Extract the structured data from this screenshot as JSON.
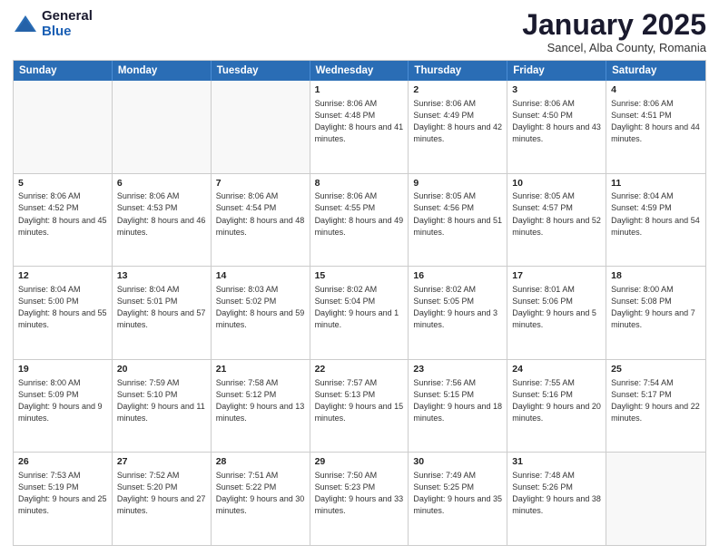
{
  "logo": {
    "general": "General",
    "blue": "Blue"
  },
  "header": {
    "month": "January 2025",
    "location": "Sancel, Alba County, Romania"
  },
  "days": [
    "Sunday",
    "Monday",
    "Tuesday",
    "Wednesday",
    "Thursday",
    "Friday",
    "Saturday"
  ],
  "weeks": [
    [
      {
        "day": "",
        "text": ""
      },
      {
        "day": "",
        "text": ""
      },
      {
        "day": "",
        "text": ""
      },
      {
        "day": "1",
        "text": "Sunrise: 8:06 AM\nSunset: 4:48 PM\nDaylight: 8 hours and 41 minutes."
      },
      {
        "day": "2",
        "text": "Sunrise: 8:06 AM\nSunset: 4:49 PM\nDaylight: 8 hours and 42 minutes."
      },
      {
        "day": "3",
        "text": "Sunrise: 8:06 AM\nSunset: 4:50 PM\nDaylight: 8 hours and 43 minutes."
      },
      {
        "day": "4",
        "text": "Sunrise: 8:06 AM\nSunset: 4:51 PM\nDaylight: 8 hours and 44 minutes."
      }
    ],
    [
      {
        "day": "5",
        "text": "Sunrise: 8:06 AM\nSunset: 4:52 PM\nDaylight: 8 hours and 45 minutes."
      },
      {
        "day": "6",
        "text": "Sunrise: 8:06 AM\nSunset: 4:53 PM\nDaylight: 8 hours and 46 minutes."
      },
      {
        "day": "7",
        "text": "Sunrise: 8:06 AM\nSunset: 4:54 PM\nDaylight: 8 hours and 48 minutes."
      },
      {
        "day": "8",
        "text": "Sunrise: 8:06 AM\nSunset: 4:55 PM\nDaylight: 8 hours and 49 minutes."
      },
      {
        "day": "9",
        "text": "Sunrise: 8:05 AM\nSunset: 4:56 PM\nDaylight: 8 hours and 51 minutes."
      },
      {
        "day": "10",
        "text": "Sunrise: 8:05 AM\nSunset: 4:57 PM\nDaylight: 8 hours and 52 minutes."
      },
      {
        "day": "11",
        "text": "Sunrise: 8:04 AM\nSunset: 4:59 PM\nDaylight: 8 hours and 54 minutes."
      }
    ],
    [
      {
        "day": "12",
        "text": "Sunrise: 8:04 AM\nSunset: 5:00 PM\nDaylight: 8 hours and 55 minutes."
      },
      {
        "day": "13",
        "text": "Sunrise: 8:04 AM\nSunset: 5:01 PM\nDaylight: 8 hours and 57 minutes."
      },
      {
        "day": "14",
        "text": "Sunrise: 8:03 AM\nSunset: 5:02 PM\nDaylight: 8 hours and 59 minutes."
      },
      {
        "day": "15",
        "text": "Sunrise: 8:02 AM\nSunset: 5:04 PM\nDaylight: 9 hours and 1 minute."
      },
      {
        "day": "16",
        "text": "Sunrise: 8:02 AM\nSunset: 5:05 PM\nDaylight: 9 hours and 3 minutes."
      },
      {
        "day": "17",
        "text": "Sunrise: 8:01 AM\nSunset: 5:06 PM\nDaylight: 9 hours and 5 minutes."
      },
      {
        "day": "18",
        "text": "Sunrise: 8:00 AM\nSunset: 5:08 PM\nDaylight: 9 hours and 7 minutes."
      }
    ],
    [
      {
        "day": "19",
        "text": "Sunrise: 8:00 AM\nSunset: 5:09 PM\nDaylight: 9 hours and 9 minutes."
      },
      {
        "day": "20",
        "text": "Sunrise: 7:59 AM\nSunset: 5:10 PM\nDaylight: 9 hours and 11 minutes."
      },
      {
        "day": "21",
        "text": "Sunrise: 7:58 AM\nSunset: 5:12 PM\nDaylight: 9 hours and 13 minutes."
      },
      {
        "day": "22",
        "text": "Sunrise: 7:57 AM\nSunset: 5:13 PM\nDaylight: 9 hours and 15 minutes."
      },
      {
        "day": "23",
        "text": "Sunrise: 7:56 AM\nSunset: 5:15 PM\nDaylight: 9 hours and 18 minutes."
      },
      {
        "day": "24",
        "text": "Sunrise: 7:55 AM\nSunset: 5:16 PM\nDaylight: 9 hours and 20 minutes."
      },
      {
        "day": "25",
        "text": "Sunrise: 7:54 AM\nSunset: 5:17 PM\nDaylight: 9 hours and 22 minutes."
      }
    ],
    [
      {
        "day": "26",
        "text": "Sunrise: 7:53 AM\nSunset: 5:19 PM\nDaylight: 9 hours and 25 minutes."
      },
      {
        "day": "27",
        "text": "Sunrise: 7:52 AM\nSunset: 5:20 PM\nDaylight: 9 hours and 27 minutes."
      },
      {
        "day": "28",
        "text": "Sunrise: 7:51 AM\nSunset: 5:22 PM\nDaylight: 9 hours and 30 minutes."
      },
      {
        "day": "29",
        "text": "Sunrise: 7:50 AM\nSunset: 5:23 PM\nDaylight: 9 hours and 33 minutes."
      },
      {
        "day": "30",
        "text": "Sunrise: 7:49 AM\nSunset: 5:25 PM\nDaylight: 9 hours and 35 minutes."
      },
      {
        "day": "31",
        "text": "Sunrise: 7:48 AM\nSunset: 5:26 PM\nDaylight: 9 hours and 38 minutes."
      },
      {
        "day": "",
        "text": ""
      }
    ]
  ]
}
